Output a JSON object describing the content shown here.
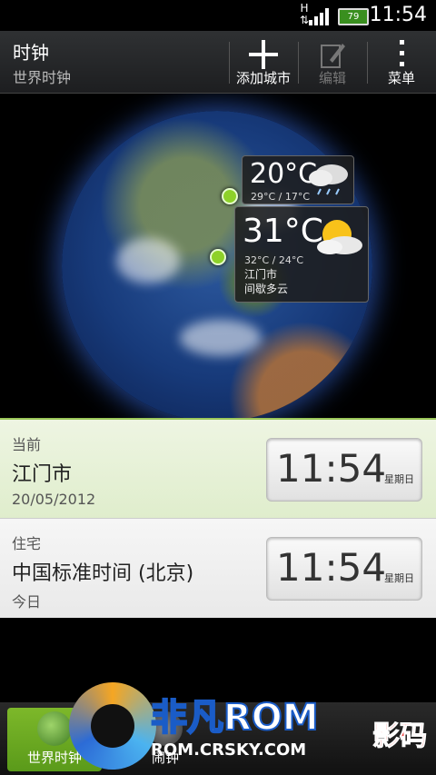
{
  "status_bar": {
    "time": "11:54",
    "battery": "79"
  },
  "action_bar": {
    "title": "时钟",
    "subtitle": "世界时钟",
    "add_city_label": "添加城市",
    "edit_label": "编辑",
    "menu_label": "菜单"
  },
  "globe": {
    "card_north": {
      "temp": "20°C",
      "range": "29°C / 17°C"
    },
    "card_main": {
      "temp": "31°C",
      "range": "32°C / 24°C",
      "city": "江门市",
      "condition": "间歇多云"
    }
  },
  "rows": [
    {
      "label": "当前",
      "name": "江门市",
      "sub": "20/05/2012",
      "time": "11:54",
      "day": "星期日"
    },
    {
      "label": "住宅",
      "name": "中国标准时间 (北京)",
      "sub": "今日",
      "time": "11:54",
      "day": "星期日"
    }
  ],
  "tab_bar": {
    "world_clock_label": "世界时钟",
    "alarm_label": "闹钟"
  },
  "watermark": {
    "brand": "非凡ROM",
    "url": "ROM.CRSKY.COM",
    "extra": "影码"
  },
  "colors": {
    "accent_green": "#7db82a",
    "highlight_row": "#eef5e2"
  }
}
